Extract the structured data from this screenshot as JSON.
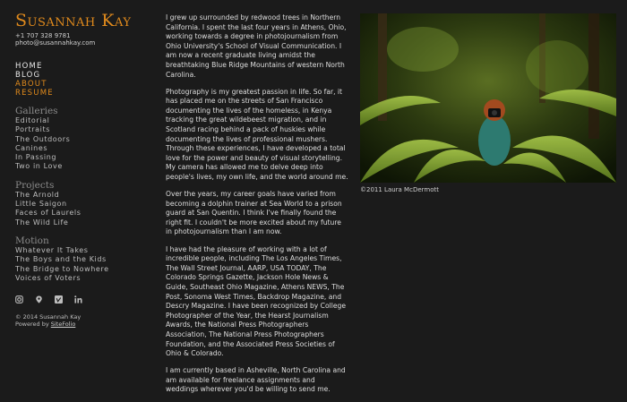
{
  "site": {
    "title": "Susannah Kay",
    "phone": "+1 707 328 9781",
    "email": "photo@susannahkay.com"
  },
  "nav": {
    "items": [
      {
        "label": "HOME",
        "active": false
      },
      {
        "label": "BLOG",
        "active": false
      },
      {
        "label": "ABOUT",
        "active": true
      },
      {
        "label": "RESUME",
        "active": true
      }
    ]
  },
  "galleries": {
    "heading": "Galleries",
    "items": [
      "Editorial",
      "Portraits",
      "The Outdoors",
      "Canines",
      "In Passing",
      "Two in Love"
    ]
  },
  "projects": {
    "heading": "Projects",
    "items": [
      "The Arnold",
      "Little Saigon",
      "Faces of Laurels",
      "The Wild Life"
    ]
  },
  "motion": {
    "heading": "Motion",
    "items": [
      "Whatever It Takes",
      "The Boys and the Kids",
      "The Bridge to Nowhere",
      "Voices of Voters"
    ]
  },
  "social": [
    "instagram-icon",
    "location-icon",
    "vimeo-icon",
    "linkedin-icon"
  ],
  "footer": {
    "copyright": "© 2014 Susannah Kay",
    "powered_prefix": "Powered by ",
    "powered_link": "SiteFolio"
  },
  "bio": {
    "paragraphs": [
      "I grew up surrounded by redwood trees in Northern California. I spent the last four years in Athens, Ohio, working towards a degree in photojournalism from Ohio University's School of Visual Communication. I am now a recent graduate living amidst the breathtaking Blue Ridge Mountains of western North Carolina.",
      "Photography is my greatest passion in life. So far, it has placed me on the streets of San Francisco documenting the lives of the homeless, in Kenya tracking the great wildebeest migration, and in Scotland racing behind a pack of huskies while documenting the lives of professional mushers. Through these experiences, I have developed a total love for the power and beauty of visual storytelling. My camera has allowed me to delve deep into people's lives, my own life, and the world around me.",
      "Over the years, my career goals have varied from becoming a dolphin trainer at Sea World to a prison guard at San Quentin. I think I've finally found the right fit. I couldn't be more excited about my future in photojournalism than I am now.",
      "I have had the pleasure of working with a lot of incredible people, including The Los Angeles Times, The Wall Street Journal, AARP, USA TODAY, The Colorado Springs Gazette, Jackson Hole News & Guide, Southeast Ohio Magazine, Athens NEWS, The Post, Sonoma West Times, Backdrop Magazine, and Descry Magazine. I have been recognized by College Photographer of the Year, the Hearst Journalism Awards, the National Press Photographers Association, The National Press Photographers Foundation, and the Associated Press Societies of Ohio & Colorado.",
      "I am currently based in Asheville, North Carolina and am available for freelance assignments and weddings wherever you'd be willing to send me."
    ]
  },
  "photo": {
    "caption": "©2011 Laura McDermott"
  }
}
